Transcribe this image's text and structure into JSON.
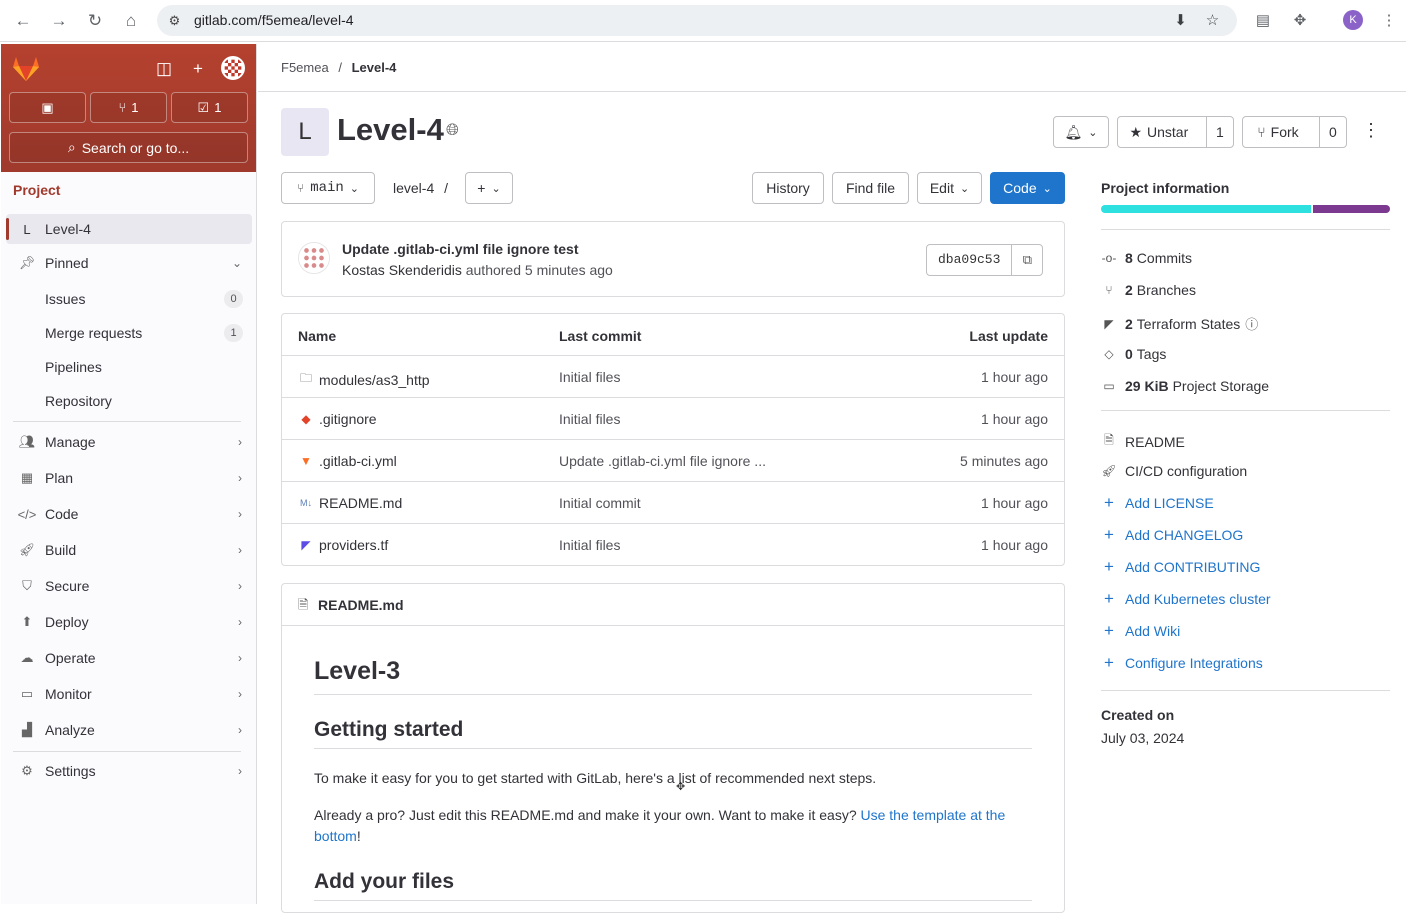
{
  "browser": {
    "url": "gitlab.com/f5emea/level-4",
    "profile_initial": "K",
    "back_icon": "arrow-left-icon",
    "forward_icon": "arrow-right-icon"
  },
  "sidebar": {
    "merge_requests_count": "1",
    "todos_count": "1",
    "search_label": "Search or go to...",
    "section_title": "Project",
    "project_initial": "L",
    "project_name": "Level-4",
    "pinned_label": "Pinned",
    "pinned_items": [
      {
        "label": "Issues",
        "count": "0"
      },
      {
        "label": "Merge requests",
        "count": "1"
      },
      {
        "label": "Pipelines"
      },
      {
        "label": "Repository"
      }
    ],
    "nav_items": [
      {
        "label": "Manage",
        "icon": "users-icon"
      },
      {
        "label": "Plan",
        "icon": "calendar-icon"
      },
      {
        "label": "Code",
        "icon": "code-icon"
      },
      {
        "label": "Build",
        "icon": "rocket-icon"
      },
      {
        "label": "Secure",
        "icon": "shield-icon"
      },
      {
        "label": "Deploy",
        "icon": "deployments-icon"
      },
      {
        "label": "Operate",
        "icon": "cloud-gear-icon"
      },
      {
        "label": "Monitor",
        "icon": "monitor-icon"
      },
      {
        "label": "Analyze",
        "icon": "chart-icon"
      }
    ],
    "settings_label": "Settings",
    "accent_color": "#a03a2c"
  },
  "breadcrumb": {
    "group": "F5emea",
    "separator": "/",
    "project": "Level-4"
  },
  "project": {
    "initial": "L",
    "title": "Level-4",
    "unstar_label": "Unstar",
    "star_count": "1",
    "fork_label": "Fork",
    "fork_count": "0"
  },
  "repo_nav": {
    "branch": "main",
    "path": "level-4",
    "path_sep": "/",
    "history_label": "History",
    "find_file_label": "Find file",
    "edit_label": "Edit",
    "code_label": "Code"
  },
  "last_commit": {
    "title": "Update .gitlab-ci.yml file ignore test",
    "author": "Kostas Skenderidis",
    "meta": "authored 5 minutes ago",
    "sha": "dba09c53"
  },
  "file_tree": {
    "headers": {
      "name": "Name",
      "last_commit": "Last commit",
      "last_update": "Last update"
    },
    "rows": [
      {
        "name": "modules/as3_http",
        "commit": "Initial files",
        "updated": "1 hour ago",
        "icon": "folder-icon"
      },
      {
        "name": ".gitignore",
        "commit": "Initial files",
        "updated": "1 hour ago",
        "icon": "git-icon"
      },
      {
        "name": ".gitlab-ci.yml",
        "commit": "Update .gitlab-ci.yml file ignore ...",
        "updated": "5 minutes ago",
        "icon": "gitlab-icon"
      },
      {
        "name": "README.md",
        "commit": "Initial commit",
        "updated": "1 hour ago",
        "icon": "markdown-icon"
      },
      {
        "name": "providers.tf",
        "commit": "Initial files",
        "updated": "1 hour ago",
        "icon": "terraform-icon"
      }
    ]
  },
  "readme": {
    "filename": "README.md",
    "h1": "Level-3",
    "h2_getting_started": "Getting started",
    "p1": "To make it easy for you to get started with GitLab, here's a list of recommended next steps.",
    "p2_text": "Already a pro? Just edit this README.md and make it your own. Want to make it easy? ",
    "p2_link": "Use the template at the bottom",
    "p2_end": "!",
    "h2_add_files": "Add your files"
  },
  "project_info": {
    "title": "Project information",
    "stats": [
      {
        "num": "8",
        "label": "Commits",
        "icon": "commit-icon"
      },
      {
        "num": "2",
        "label": "Branches",
        "icon": "branch-icon"
      },
      {
        "num": "2",
        "label": "Terraform States",
        "icon": "terraform-icon"
      },
      {
        "num": "0",
        "label": "Tags",
        "icon": "tag-icon"
      },
      {
        "num": "29 KiB",
        "label": "Project Storage",
        "icon": "disk-icon"
      }
    ],
    "links_plain": [
      "README",
      "CI/CD configuration"
    ],
    "links_add": [
      "Add LICENSE",
      "Add CHANGELOG",
      "Add CONTRIBUTING",
      "Add Kubernetes cluster",
      "Add Wiki",
      "Configure Integrations"
    ],
    "created_label": "Created on",
    "created_value": "July 03, 2024",
    "language_colors": [
      "#2ee0e0",
      "#7b3a8f"
    ]
  }
}
